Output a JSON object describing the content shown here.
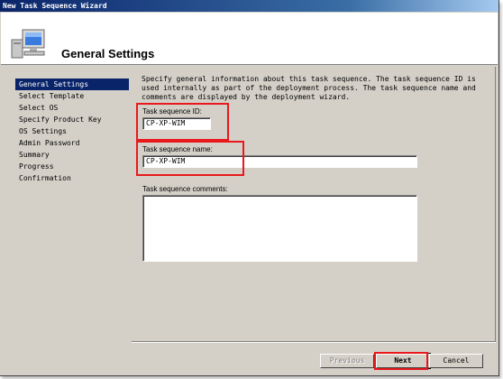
{
  "window": {
    "title": "New Task Sequence Wizard"
  },
  "header": {
    "title": "General Settings",
    "icon": "computer-monitor-icon"
  },
  "nav": {
    "items": [
      {
        "label": "General Settings",
        "selected": true
      },
      {
        "label": "Select Template",
        "selected": false
      },
      {
        "label": "Select OS",
        "selected": false
      },
      {
        "label": "Specify Product Key",
        "selected": false
      },
      {
        "label": "OS Settings",
        "selected": false
      },
      {
        "label": "Admin Password",
        "selected": false
      },
      {
        "label": "Summary",
        "selected": false
      },
      {
        "label": "Progress",
        "selected": false
      },
      {
        "label": "Confirmation",
        "selected": false
      }
    ]
  },
  "main": {
    "description": "Specify general information about this task sequence.  The task sequence ID is used internally as part of the deployment process.  The task sequence name and comments are displayed by the deployment wizard.",
    "id_label": "Task sequence ID:",
    "id_value": "CP-XP-WIM",
    "name_label": "Task sequence name:",
    "name_value": "CP-XP-WIM",
    "comments_label": "Task sequence comments:",
    "comments_value": ""
  },
  "buttons": {
    "previous": "Previous",
    "next": "Next",
    "cancel": "Cancel"
  },
  "colors": {
    "title_bar": "#0a246a",
    "selection": "#0a246a",
    "highlight_box": "#e8181d",
    "face": "#d4d0c8"
  }
}
